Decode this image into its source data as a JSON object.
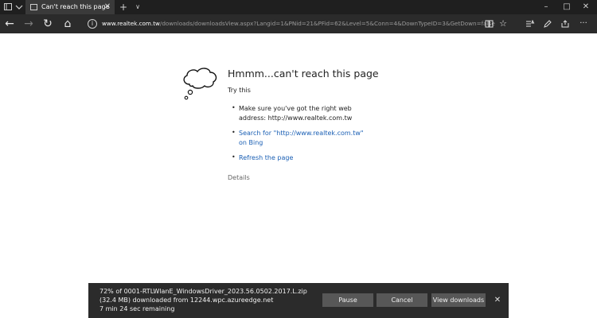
{
  "titlebar": {
    "tab_title": "Can't reach this page",
    "new_tab": "+",
    "tab_menu": "∨",
    "minimize": "–",
    "maximize": "□",
    "close": "✕",
    "tab_close": "✕"
  },
  "toolbar": {
    "back": "←",
    "forward": "→",
    "refresh": "↻",
    "home": "⌂",
    "address_host": "www.realtek.com.tw",
    "address_path": "/downloads/downloadsView.aspx?Langid=1&PNid=21&PFid=62&Level=5&Conn=4&DownTypeID=3&GetDown=false",
    "icons": [
      "reading-view-icon",
      "favorite-star-icon",
      "hub-icon",
      "pen-icon",
      "share-icon",
      "more-icon"
    ]
  },
  "error_page": {
    "title": "Hmmm...can't reach this page",
    "try_this": "Try this",
    "suggestions": [
      "Make sure you've got the right web address: http://www.realtek.com.tw",
      "Search for \"http://www.realtek.com.tw\" on Bing",
      "Refresh the page"
    ],
    "details": "Details"
  },
  "download": {
    "status": "72% of 0001-RTLWlanE_WindowsDriver_2023.56.0502.2017.L.zip (32.4 MB) downloaded from 12244.wpc.azureedge.net",
    "remaining": "7 min 24 sec remaining",
    "pause_label": "Pause",
    "cancel_label": "Cancel",
    "view_label": "View downloads",
    "close": "✕",
    "progress_percent": 72
  },
  "colors": {
    "chrome_dark": "#1f1f1f",
    "toolbar": "#2b2b2b",
    "link": "#1a5fb4",
    "download_bar": "#2b2b2b",
    "button": "#575757"
  }
}
